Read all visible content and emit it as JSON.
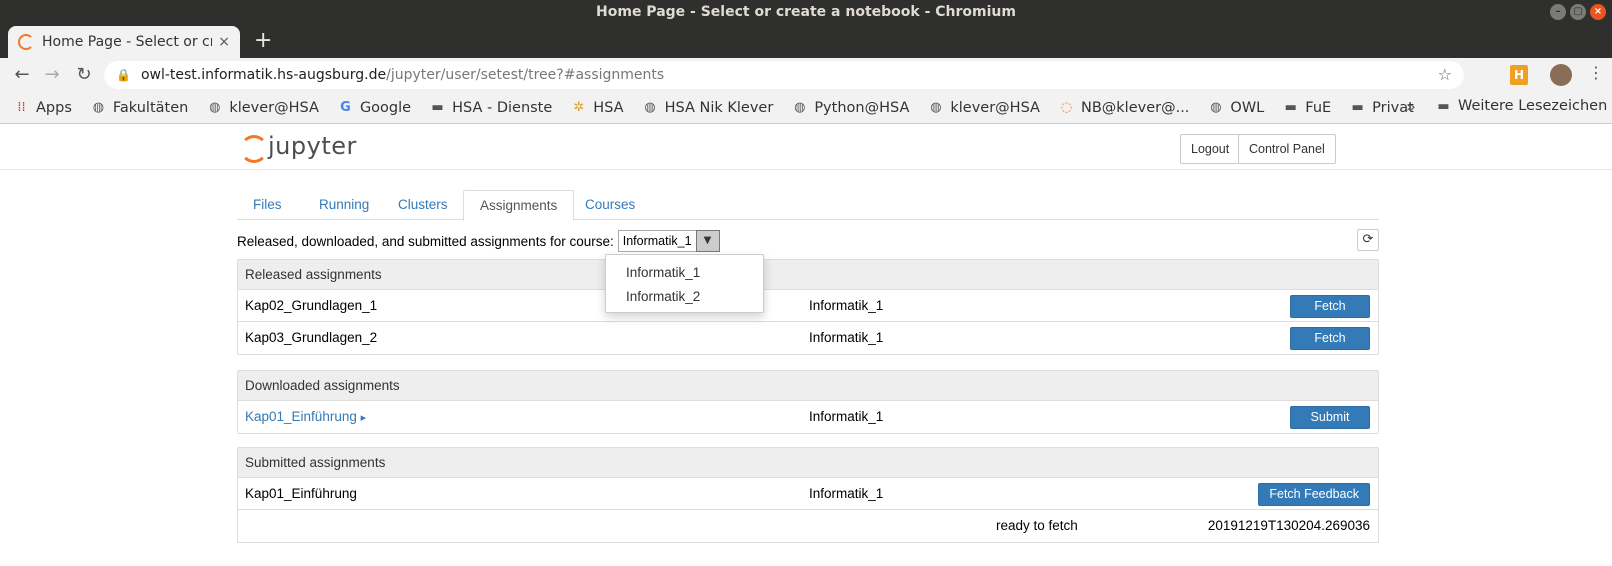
{
  "window": {
    "title": "Home Page - Select or create a notebook - Chromium",
    "controls": {
      "minimize": "–",
      "maximize": "▢",
      "close": "×"
    }
  },
  "browser": {
    "tab_title": "Home Page - Select or cre",
    "tab_close": "×",
    "new_tab": "+",
    "url_host": "owl-test.informatik.hs-augsburg.de",
    "url_path": "/jupyter/user/setest/tree?#assignments",
    "extension_label": "H",
    "icons": {
      "back": "←",
      "forward": "→",
      "reload": "↻",
      "lock": "🔒",
      "star": "☆",
      "menu": "⋮"
    }
  },
  "bookmarks": {
    "items": [
      {
        "label": "Apps",
        "icon": "⁞⁞",
        "icon_name": "apps-grid-icon"
      },
      {
        "label": "Fakultäten",
        "icon": "◍",
        "icon_name": "globe-icon"
      },
      {
        "label": "klever@HSA",
        "icon": "◍",
        "icon_name": "globe-icon"
      },
      {
        "label": "Google",
        "icon": "G",
        "icon_name": "google-icon"
      },
      {
        "label": "HSA - Dienste",
        "icon": "▬",
        "icon_name": "folder-icon"
      },
      {
        "label": "HSA",
        "icon": "✲",
        "icon_name": "hsa-icon"
      },
      {
        "label": "HSA Nik Klever",
        "icon": "◍",
        "icon_name": "globe-icon"
      },
      {
        "label": "Python@HSA",
        "icon": "◍",
        "icon_name": "globe-icon"
      },
      {
        "label": "klever@HSA",
        "icon": "◍",
        "icon_name": "globe-icon"
      },
      {
        "label": "NB@klever@...",
        "icon": "◌",
        "icon_name": "jupyter-icon"
      },
      {
        "label": "OWL",
        "icon": "◍",
        "icon_name": "globe-icon"
      },
      {
        "label": "FuE",
        "icon": "▬",
        "icon_name": "folder-icon"
      },
      {
        "label": "Privat",
        "icon": "▬",
        "icon_name": "folder-icon"
      }
    ],
    "more": "»",
    "other_label": "Weitere Lesezeichen",
    "other_icon": "▬"
  },
  "jupyter": {
    "logo_text": "jupyter",
    "logout": "Logout",
    "control_panel": "Control Panel",
    "tabs": [
      "Files",
      "Running",
      "Clusters",
      "Assignments",
      "Courses"
    ],
    "course_label": "Released, downloaded, and submitted assignments for course:",
    "selected_course": "Informatik_1",
    "caret": "▼",
    "refresh_icon": "⟳",
    "course_options": [
      "Informatik_1",
      "Informatik_2"
    ]
  },
  "released": {
    "title": "Released assignments",
    "rows": [
      {
        "name": "Kap02_Grundlagen_1",
        "course": "Informatik_1",
        "action": "Fetch"
      },
      {
        "name": "Kap03_Grundlagen_2",
        "course": "Informatik_1",
        "action": "Fetch"
      }
    ]
  },
  "downloaded": {
    "title": "Downloaded assignments",
    "rows": [
      {
        "name": "Kap01_Einführung",
        "expander": "▸",
        "course": "Informatik_1",
        "action": "Submit"
      }
    ]
  },
  "submitted": {
    "title": "Submitted assignments",
    "rows": [
      {
        "name": "Kap01_Einführung",
        "course": "Informatik_1",
        "action": "Fetch Feedback"
      }
    ],
    "detail": {
      "status": "ready to fetch",
      "timestamp": "20191219T130204.269036"
    }
  }
}
